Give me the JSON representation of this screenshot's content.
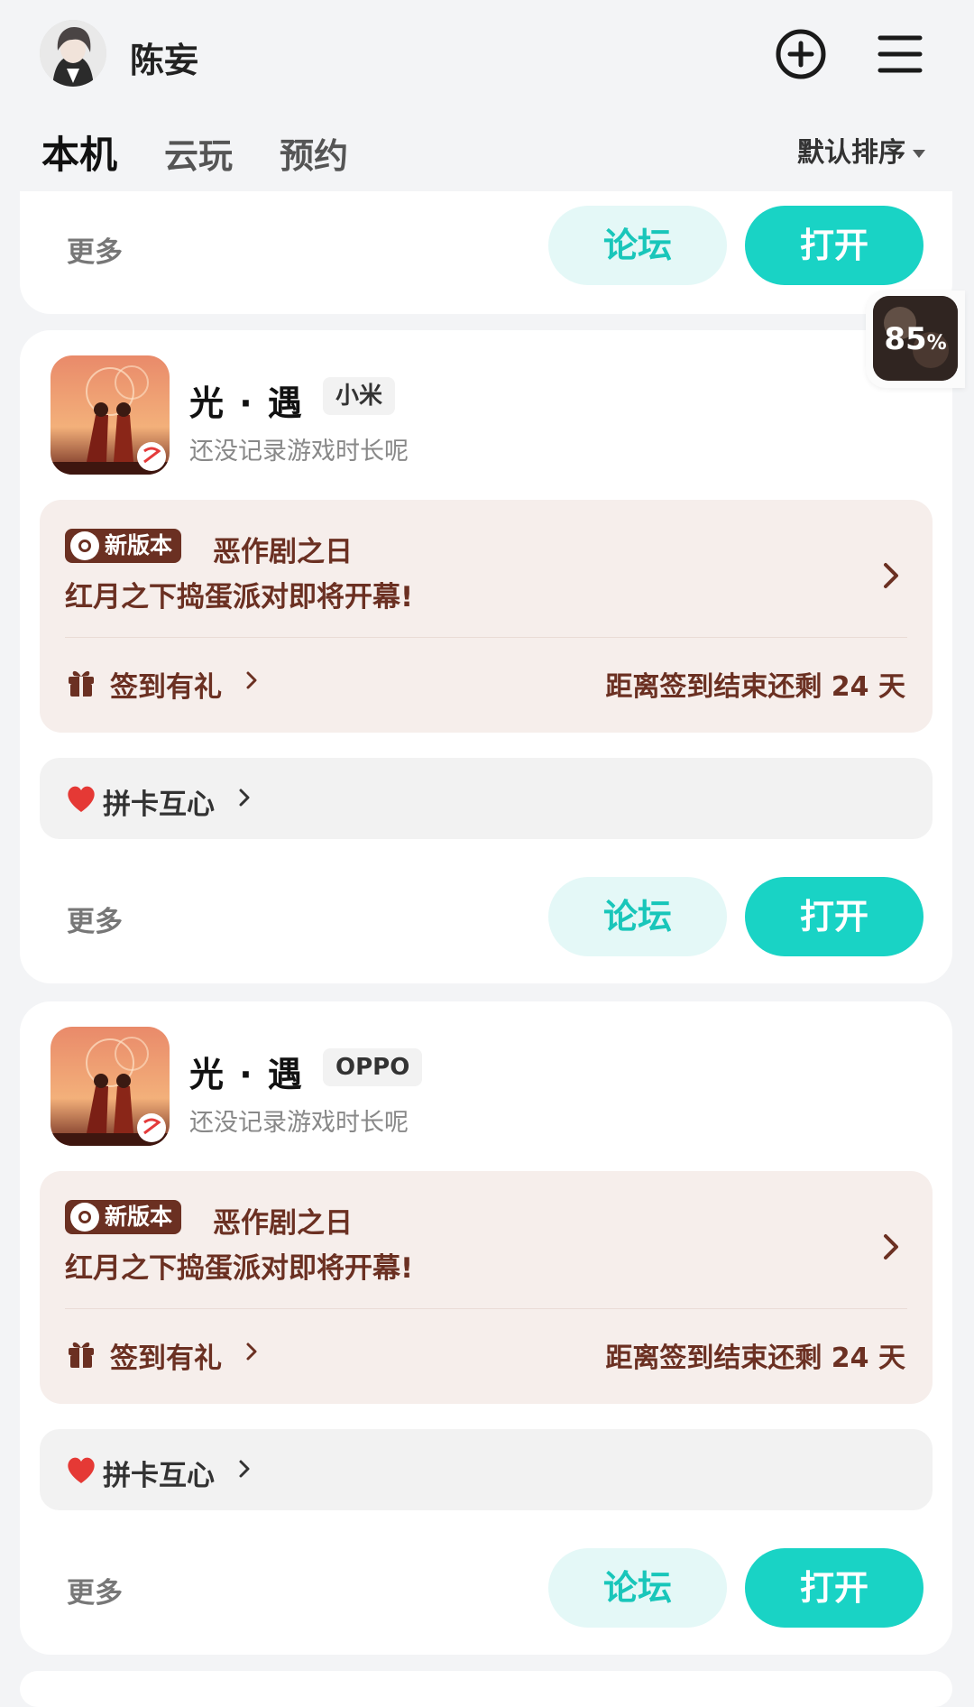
{
  "header": {
    "username": "陈妄",
    "tabs": [
      {
        "label": "本机",
        "active": true
      },
      {
        "label": "云玩",
        "active": false
      },
      {
        "label": "预约",
        "active": false
      }
    ],
    "sort_label": "默认排序",
    "icons": {
      "add": "plus-circle-icon",
      "menu": "hamburger-menu-icon"
    }
  },
  "partial_card": {
    "more": "更多",
    "forum": "论坛",
    "open": "打开"
  },
  "float_widget": {
    "value": "85",
    "unit": "%"
  },
  "games": [
    {
      "title": "光 · 遇",
      "channel": "小米",
      "subtitle": "还没记录游戏时长呢",
      "event": {
        "badge": "新版本",
        "title": "恶作剧之日",
        "desc": "红月之下捣蛋派对即将开幕!"
      },
      "gift_label": "签到有礼",
      "countdown": "距离签到结束还剩 24 天",
      "heart_label": "拼卡互心",
      "more": "更多",
      "forum": "论坛",
      "open": "打开"
    },
    {
      "title": "光 · 遇",
      "channel": "OPPO",
      "subtitle": "还没记录游戏时长呢",
      "event": {
        "badge": "新版本",
        "title": "恶作剧之日",
        "desc": "红月之下捣蛋派对即将开幕!"
      },
      "gift_label": "签到有礼",
      "countdown": "距离签到结束还剩 24 天",
      "heart_label": "拼卡互心",
      "more": "更多",
      "forum": "论坛",
      "open": "打开"
    }
  ],
  "colors": {
    "accent": "#19d3c5",
    "event_text": "#6b3022",
    "event_bg": "#f6eeeb"
  }
}
